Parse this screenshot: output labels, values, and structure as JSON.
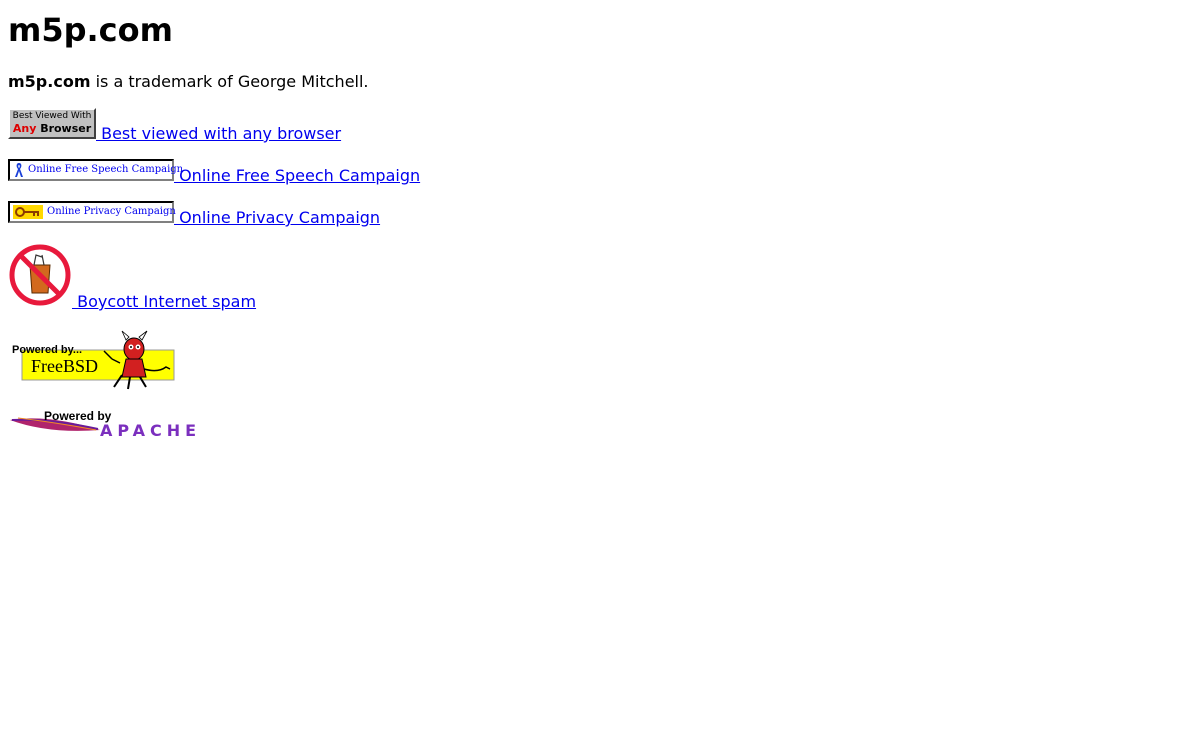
{
  "header": {
    "title": "m5p.com"
  },
  "trademark": {
    "brand": "m5p.com",
    "text": " is a trademark of George Mitchell."
  },
  "links": {
    "browser": {
      "badge_line1": "Best Viewed With",
      "badge_any": "Any",
      "badge_browser": " Browser",
      "label": " Best viewed with any browser"
    },
    "speech": {
      "badge_text": "Online Free Speech Campaign",
      "label": " Online Free Speech Campaign"
    },
    "privacy": {
      "badge_text": "Online Privacy Campaign",
      "label": " Online Privacy Campaign"
    },
    "spam": {
      "label": " Boycott Internet spam"
    }
  },
  "logos": {
    "freebsd": {
      "powered": "Powered by...",
      "name": "FreeBSD"
    },
    "apache": {
      "powered": "Powered by",
      "name": "APACHE"
    }
  },
  "colors": {
    "link": "#0000ee",
    "freebsd_bg": "#ffff00",
    "nospam_red": "#e8193c",
    "spam_can": "#d2691e"
  },
  "icons": [
    "ribbon-icon",
    "key-icon",
    "no-spam-icon",
    "freebsd-daemon-icon",
    "apache-feather-icon"
  ]
}
